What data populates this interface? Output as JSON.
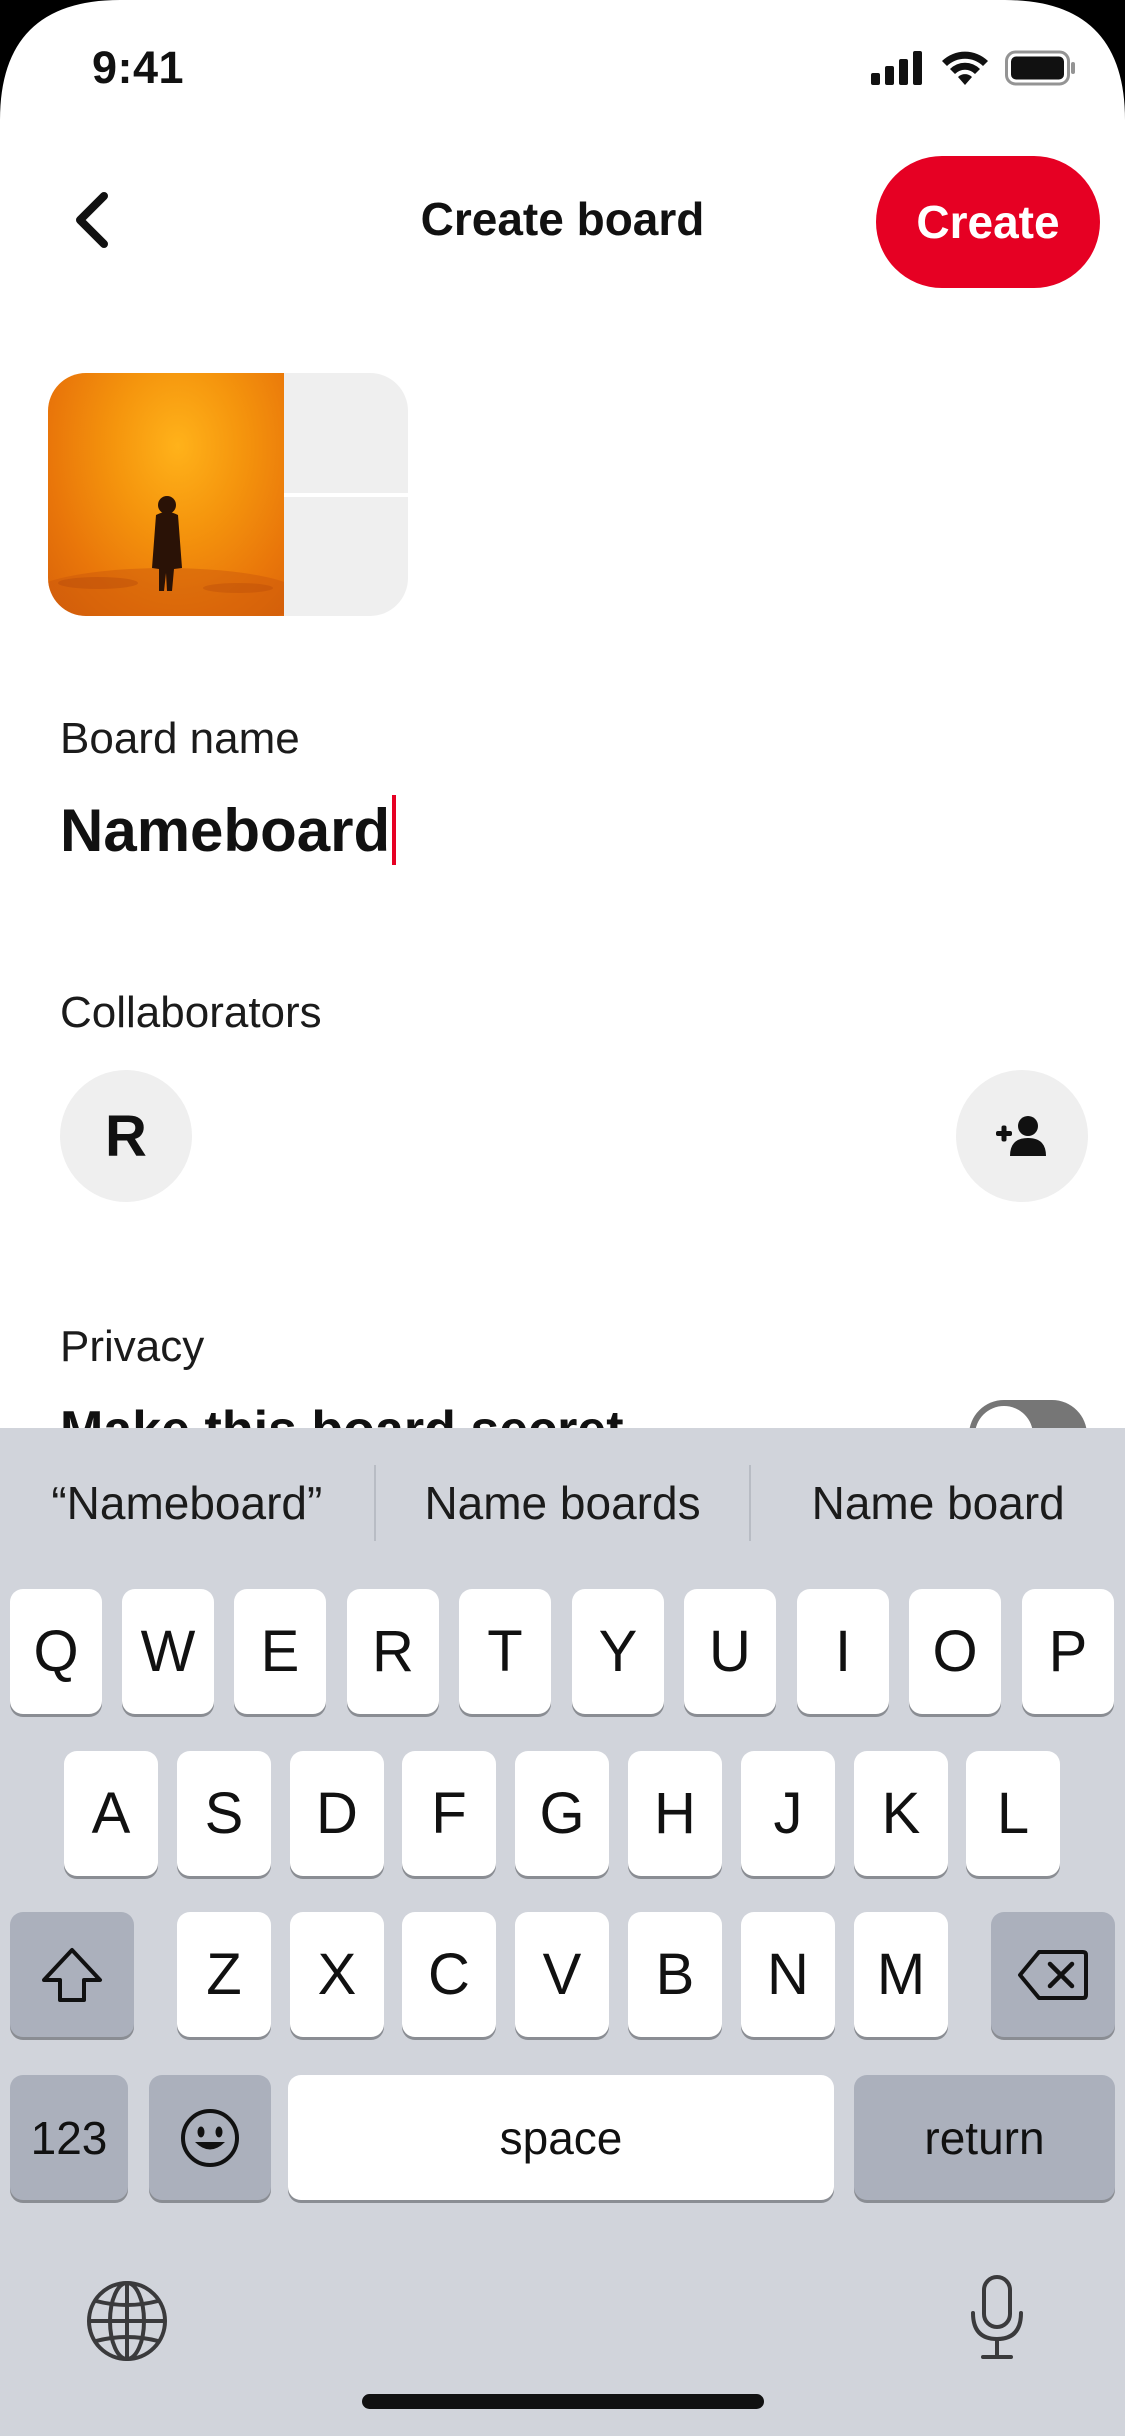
{
  "status_bar": {
    "time": "9:41",
    "icons": [
      "cellular-signal-icon",
      "wifi-icon",
      "battery-icon"
    ]
  },
  "header": {
    "title": "Create board",
    "create_label": "Create",
    "back_icon": "chevron-left-icon"
  },
  "colors": {
    "accent": "#e60023",
    "keyboard_bg": "#d1d4db",
    "chip_bg": "#efefef"
  },
  "board_cover": {
    "image": "silhouette-in-orange-haze"
  },
  "form": {
    "board_name_label": "Board name",
    "board_name_value": "Nameboard",
    "collaborators_label": "Collaborators",
    "collaborator_initial": "R",
    "add_collaborator_icon": "add-person-icon",
    "privacy_label": "Privacy",
    "secret_label": "Make this board secret",
    "secret_toggle_on": false
  },
  "keyboard": {
    "suggestions": [
      "“Nameboard”",
      "Name boards",
      "Name board"
    ],
    "row1": [
      "Q",
      "W",
      "E",
      "R",
      "T",
      "Y",
      "U",
      "I",
      "O",
      "P"
    ],
    "row2": [
      "A",
      "S",
      "D",
      "F",
      "G",
      "H",
      "J",
      "K",
      "L"
    ],
    "row3": [
      "Z",
      "X",
      "C",
      "V",
      "B",
      "N",
      "M"
    ],
    "numbers_label": "123",
    "space_label": "space",
    "return_label": "return",
    "shift_icon": "shift-icon",
    "delete_icon": "delete-icon",
    "emoji_icon": "emoji-icon",
    "globe_icon": "globe-icon",
    "mic_icon": "microphone-icon"
  }
}
